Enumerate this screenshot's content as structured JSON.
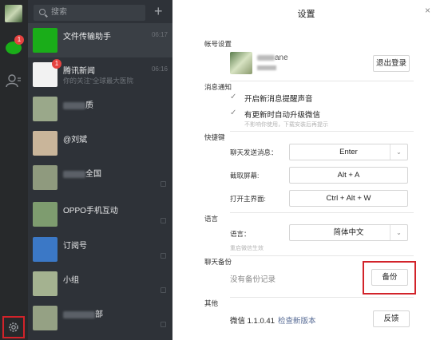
{
  "sidebar": {
    "chat_badge": "1",
    "icons": [
      "avatar",
      "chat-icon",
      "contacts-icon",
      "settings-icon"
    ]
  },
  "chat_list": {
    "search_placeholder": "搜索",
    "plus": "+",
    "rows": [
      {
        "name": "文件传输助手",
        "preview": "",
        "time": "06:17",
        "badge": "",
        "avatar_color": "#1aad19"
      },
      {
        "name": "腾讯新闻",
        "preview": "你的关注“全球最大医院",
        "time": "06:16",
        "badge": "1",
        "avatar_color": "#f2f2f2"
      },
      {
        "name": "质",
        "preview": "",
        "time": "",
        "badge": "",
        "avatar_color": "#9aa88a"
      },
      {
        "name": "@刘斌",
        "preview": "",
        "time": "",
        "badge": "",
        "avatar_color": "#c9b59a"
      },
      {
        "name": "全国",
        "preview": "",
        "time": "",
        "badge": "",
        "avatar_color": "#8f9a7e"
      },
      {
        "name": "OPPO手机互动",
        "preview": "",
        "time": "",
        "badge": "",
        "avatar_color": "#7e9c6f"
      },
      {
        "name": "订阅号",
        "preview": "",
        "time": "",
        "badge": "",
        "avatar_color": "#3b78c6"
      },
      {
        "name": "小组",
        "preview": "",
        "time": "",
        "badge": "",
        "avatar_color": "#a4b290"
      },
      {
        "name": "部",
        "preview": "",
        "time": "",
        "badge": "",
        "avatar_color": "#95a184"
      }
    ]
  },
  "settings": {
    "title": "设置",
    "close": "×",
    "account": {
      "label": "帐号设置",
      "name": "ane",
      "logout": "退出登录"
    },
    "notifications": {
      "label": "消息通知",
      "items": [
        {
          "check": "✓",
          "label": "开启新消息提醒声音",
          "hint": ""
        },
        {
          "check": "✓",
          "label": "有更新时自动升级微信",
          "hint": "不影响你使用，下载安装后再提示"
        }
      ]
    },
    "shortcuts": {
      "label": "快捷键",
      "items": [
        {
          "label": "聊天发送消息：",
          "value": "Enter",
          "caret": "⌄"
        },
        {
          "label": "截取屏幕:",
          "value": "Alt + A",
          "caret": ""
        },
        {
          "label": "打开主界面:",
          "value": "Ctrl + Alt + W",
          "caret": ""
        }
      ]
    },
    "language": {
      "label": "语言",
      "field": "语言：",
      "value": "简体中文",
      "caret": "⌄",
      "hint": "重启微信生效"
    },
    "backup": {
      "label": "聊天备份",
      "text": "没有备份记录",
      "button": "备份"
    },
    "other": {
      "label": "其他",
      "version": "微信 1.1.0.41",
      "check_update": "检查新版本",
      "feedback": "反馈"
    }
  },
  "colors": {
    "highlight": "#d2232a",
    "green": "#1aad19",
    "link": "#576b95"
  }
}
